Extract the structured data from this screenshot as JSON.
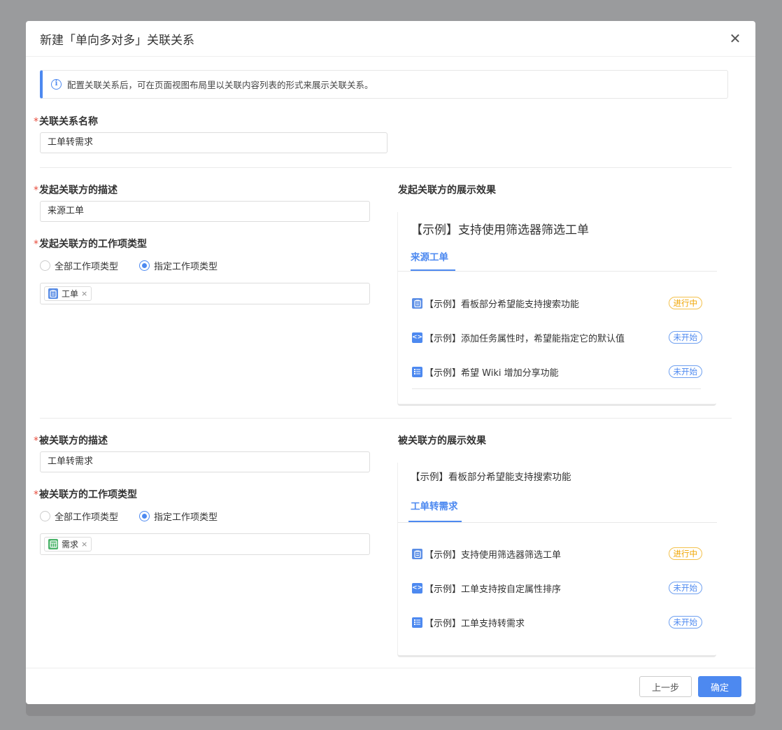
{
  "modal": {
    "title": "新建「单向多对多」关联关系",
    "close_glyph": "✕"
  },
  "info": {
    "icon": "info-icon",
    "text": "配置关联关系后，可在页面视图布局里以关联内容列表的形式来展示关联关系。"
  },
  "relation_name": {
    "required_mark": "*",
    "label": "关联关系名称",
    "value": "工单转需求"
  },
  "initiator": {
    "desc_label": "发起关联方的描述",
    "desc_value": "来源工单",
    "type_label": "发起关联方的工作项类型",
    "radio_all": "全部工作项类型",
    "radio_specific": "指定工作项类型",
    "selected": "specific",
    "tag": {
      "label": "工单",
      "icon": "clipboard-icon",
      "color": "#5b8ee6"
    },
    "preview_title": "发起关联方的展示效果",
    "preview": {
      "heading": "【示例】支持使用筛选器筛选工单",
      "tab": "来源工单",
      "rows": [
        {
          "icon": "clipboard-icon",
          "icon_color": "#5b8ee6",
          "text": "【示例】看板部分希望能支持搜索功能",
          "status": "进行中",
          "status_kind": "progress"
        },
        {
          "icon": "code-icon",
          "icon_color": "#4d89f0",
          "text": "【示例】添加任务属性时，希望能指定它的默认值",
          "status": "未开始",
          "status_kind": "notstart"
        },
        {
          "icon": "list-icon",
          "icon_color": "#4d89f0",
          "text": "【示例】希望 Wiki 增加分享功能",
          "status": "未开始",
          "status_kind": "notstart"
        }
      ]
    }
  },
  "target": {
    "desc_label": "被关联方的描述",
    "desc_value": "工单转需求",
    "type_label": "被关联方的工作项类型",
    "radio_all": "全部工作项类型",
    "radio_specific": "指定工作项类型",
    "selected": "specific",
    "tag": {
      "label": "需求",
      "icon": "requirement-icon",
      "color": "#4cb46b"
    },
    "preview_title": "被关联方的展示效果",
    "preview": {
      "heading": "【示例】看板部分希望能支持搜索功能",
      "tab": "工单转需求",
      "rows": [
        {
          "icon": "clipboard-icon",
          "icon_color": "#5b8ee6",
          "text": "【示例】支持使用筛选器筛选工单",
          "status": "进行中",
          "status_kind": "progress"
        },
        {
          "icon": "code-icon",
          "icon_color": "#4d89f0",
          "text": "【示例】工单支持按自定属性排序",
          "status": "未开始",
          "status_kind": "notstart"
        },
        {
          "icon": "list-icon",
          "icon_color": "#4d89f0",
          "text": "【示例】工单支持转需求",
          "status": "未开始",
          "status_kind": "notstart"
        }
      ]
    }
  },
  "footer": {
    "prev_label": "上一步",
    "ok_label": "确定"
  }
}
